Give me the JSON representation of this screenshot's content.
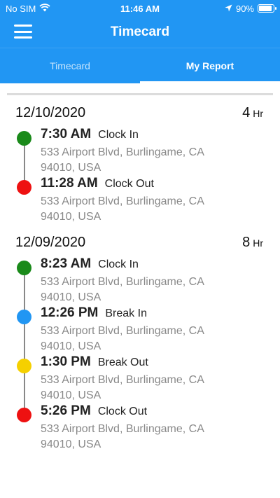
{
  "status": {
    "carrier": "No SIM",
    "time": "11:46 AM",
    "battery": "90%",
    "battery_level": 0.9
  },
  "nav": {
    "title": "Timecard"
  },
  "tabs": [
    {
      "label": "Timecard",
      "active": false
    },
    {
      "label": "My Report",
      "active": true
    }
  ],
  "days": [
    {
      "date": "12/10/2020",
      "hours": "4",
      "unit": "Hr",
      "entries": [
        {
          "time": "7:30 AM",
          "type": "Clock In",
          "addr1": "533 Airport Blvd, Burlingame, CA",
          "addr2": "94010, USA",
          "color": "#1a8a1a"
        },
        {
          "time": "11:28 AM",
          "type": "Clock Out",
          "addr1": "533 Airport Blvd, Burlingame, CA",
          "addr2": "94010, USA",
          "color": "#ee1111"
        }
      ]
    },
    {
      "date": "12/09/2020",
      "hours": "8",
      "unit": "Hr",
      "entries": [
        {
          "time": "8:23 AM",
          "type": "Clock In",
          "addr1": "533 Airport Blvd, Burlingame, CA",
          "addr2": "94010, USA",
          "color": "#1a8a1a"
        },
        {
          "time": "12:26 PM",
          "type": "Break In",
          "addr1": "533 Airport Blvd, Burlingame, CA",
          "addr2": "94010, USA",
          "color": "#2196F3"
        },
        {
          "time": "1:30 PM",
          "type": "Break Out",
          "addr1": "533 Airport Blvd, Burlingame, CA",
          "addr2": "94010, USA",
          "color": "#f5d000"
        },
        {
          "time": "5:26 PM",
          "type": "Clock Out",
          "addr1": "533 Airport Blvd, Burlingame, CA",
          "addr2": "94010, USA",
          "color": "#ee1111"
        }
      ]
    }
  ]
}
